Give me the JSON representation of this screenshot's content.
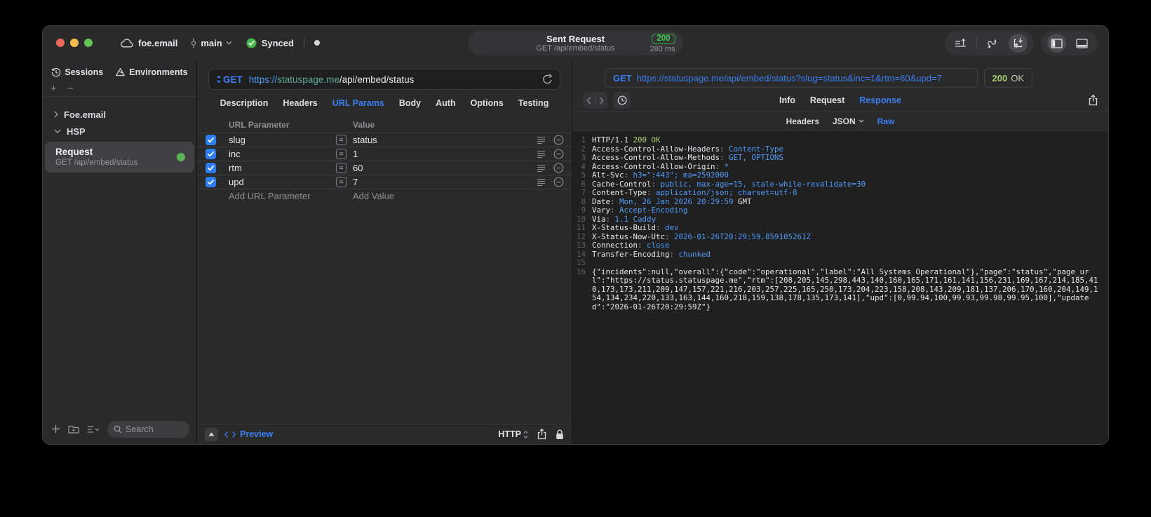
{
  "titlebar": {
    "project": "foe.email",
    "branch": "main",
    "sync_label": "Synced",
    "center": {
      "title": "Sent Request",
      "subtitle": "GET /api/embed/status",
      "status_code": "200",
      "duration": "280 ms"
    }
  },
  "sidebar": {
    "tabs": [
      {
        "label": "Sessions",
        "icon": "history-icon"
      },
      {
        "label": "Environments",
        "icon": "environments-icon"
      }
    ],
    "tree": [
      {
        "label": "Foe.email",
        "state": "collapsed"
      },
      {
        "label": "HSP",
        "state": "expanded"
      }
    ],
    "selected_request": {
      "title": "Request",
      "subtitle": "GET /api/embed/status"
    },
    "search_placeholder": "Search"
  },
  "request_editor": {
    "method": "GET",
    "url": {
      "scheme": "https://",
      "host": "statuspage.me",
      "path": "/api/embed/status"
    },
    "tabs": [
      "Description",
      "Headers",
      "URL Params",
      "Body",
      "Auth",
      "Options",
      "Testing"
    ],
    "active_tab": "URL Params",
    "params": {
      "col_name": "URL Parameter",
      "col_value": "Value",
      "rows": [
        {
          "name": "slug",
          "value": "status",
          "checked": true
        },
        {
          "name": "inc",
          "value": "1",
          "checked": true
        },
        {
          "name": "rtm",
          "value": "60",
          "checked": true
        },
        {
          "name": "upd",
          "value": "7",
          "checked": true
        }
      ],
      "add_name": "Add URL Parameter",
      "add_value": "Add Value"
    },
    "footer": {
      "preview": "Preview",
      "protocol": "HTTP"
    }
  },
  "response_viewer": {
    "request_line": {
      "method": "GET",
      "url": "https://statuspage.me/api/embed/status?slug=status&inc=1&rtm=60&upd=7"
    },
    "status": {
      "code": "200",
      "text": "OK"
    },
    "tabs": [
      "Info",
      "Request",
      "Response"
    ],
    "active_tab": "Response",
    "subtabs": [
      {
        "label": "Headers"
      },
      {
        "label": "JSON",
        "has_dropdown": true
      },
      {
        "label": "Raw"
      }
    ],
    "active_subtab": "Raw",
    "lines": [
      {
        "n": "1",
        "segs": [
          {
            "t": "HTTP/1.1 ",
            "c": "k"
          },
          {
            "t": "200 OK",
            "c": "g"
          }
        ]
      },
      {
        "n": "2",
        "segs": [
          {
            "t": "Access-Control-Allow-Headers",
            "c": "k"
          },
          {
            "t": ": ",
            "c": "d"
          },
          {
            "t": "Content-Type",
            "c": "v"
          }
        ]
      },
      {
        "n": "3",
        "segs": [
          {
            "t": "Access-Control-Allow-Methods",
            "c": "k"
          },
          {
            "t": ": ",
            "c": "d"
          },
          {
            "t": "GET, OPTIONS",
            "c": "v"
          }
        ]
      },
      {
        "n": "4",
        "segs": [
          {
            "t": "Access-Control-Allow-Origin",
            "c": "k"
          },
          {
            "t": ": ",
            "c": "d"
          },
          {
            "t": "*",
            "c": "v"
          }
        ]
      },
      {
        "n": "5",
        "segs": [
          {
            "t": "Alt-Svc",
            "c": "k"
          },
          {
            "t": ": ",
            "c": "d"
          },
          {
            "t": "h3=\":443\"; ma=2592000",
            "c": "v"
          }
        ]
      },
      {
        "n": "6",
        "segs": [
          {
            "t": "Cache-Control",
            "c": "k"
          },
          {
            "t": ": ",
            "c": "d"
          },
          {
            "t": "public, max-age=15, stale-while-revalidate=30",
            "c": "v"
          }
        ]
      },
      {
        "n": "7",
        "segs": [
          {
            "t": "Content-Type",
            "c": "k"
          },
          {
            "t": ": ",
            "c": "d"
          },
          {
            "t": "application/json; charset=utf-8",
            "c": "v"
          }
        ]
      },
      {
        "n": "8",
        "segs": [
          {
            "t": "Date",
            "c": "k"
          },
          {
            "t": ": ",
            "c": "d"
          },
          {
            "t": "Mon, 26 Jan 2026 20:29:59 ",
            "c": "v"
          },
          {
            "t": "GMT",
            "c": "k"
          }
        ]
      },
      {
        "n": "9",
        "segs": [
          {
            "t": "Vary",
            "c": "k"
          },
          {
            "t": ": ",
            "c": "d"
          },
          {
            "t": "Accept-Encoding",
            "c": "v"
          }
        ]
      },
      {
        "n": "10",
        "segs": [
          {
            "t": "Via",
            "c": "k"
          },
          {
            "t": ": ",
            "c": "d"
          },
          {
            "t": "1.1 Caddy",
            "c": "v"
          }
        ]
      },
      {
        "n": "11",
        "segs": [
          {
            "t": "X-Status-Build",
            "c": "k"
          },
          {
            "t": ": ",
            "c": "d"
          },
          {
            "t": "dev",
            "c": "v"
          }
        ]
      },
      {
        "n": "12",
        "segs": [
          {
            "t": "X-Status-Now-Utc",
            "c": "k"
          },
          {
            "t": ": ",
            "c": "d"
          },
          {
            "t": "2026-01-26T20:29:59.859105261Z",
            "c": "v"
          }
        ]
      },
      {
        "n": "13",
        "segs": [
          {
            "t": "Connection",
            "c": "k"
          },
          {
            "t": ": ",
            "c": "d"
          },
          {
            "t": "close",
            "c": "v"
          }
        ]
      },
      {
        "n": "14",
        "segs": [
          {
            "t": "Transfer-Encoding",
            "c": "k"
          },
          {
            "t": ": ",
            "c": "d"
          },
          {
            "t": "chunked",
            "c": "v"
          }
        ]
      },
      {
        "n": "15",
        "segs": []
      },
      {
        "n": "16",
        "segs": [
          {
            "t": "{\"incidents\":null,\"overall\":{\"code\":\"operational\",\"label\":\"All Systems Operational\"},\"page\":\"status\",\"page_url\":\"https://status.statuspage.me\",\"rtm\":[208,205,145,298,443,140,160,165,171,161,141,156,231,169,167,214,185,410,173,173,211,209,147,157,221,216,203,257,225,165,250,173,204,223,158,208,143,209,181,137,206,170,160,204,149,154,134,234,220,133,163,144,160,218,159,138,178,135,173,141],\"upd\":[0,99.94,100,99.93,99.98,99.95,100],\"updated\":\"2026-01-26T20:29:59Z\"}",
            "c": "k"
          }
        ]
      }
    ]
  }
}
